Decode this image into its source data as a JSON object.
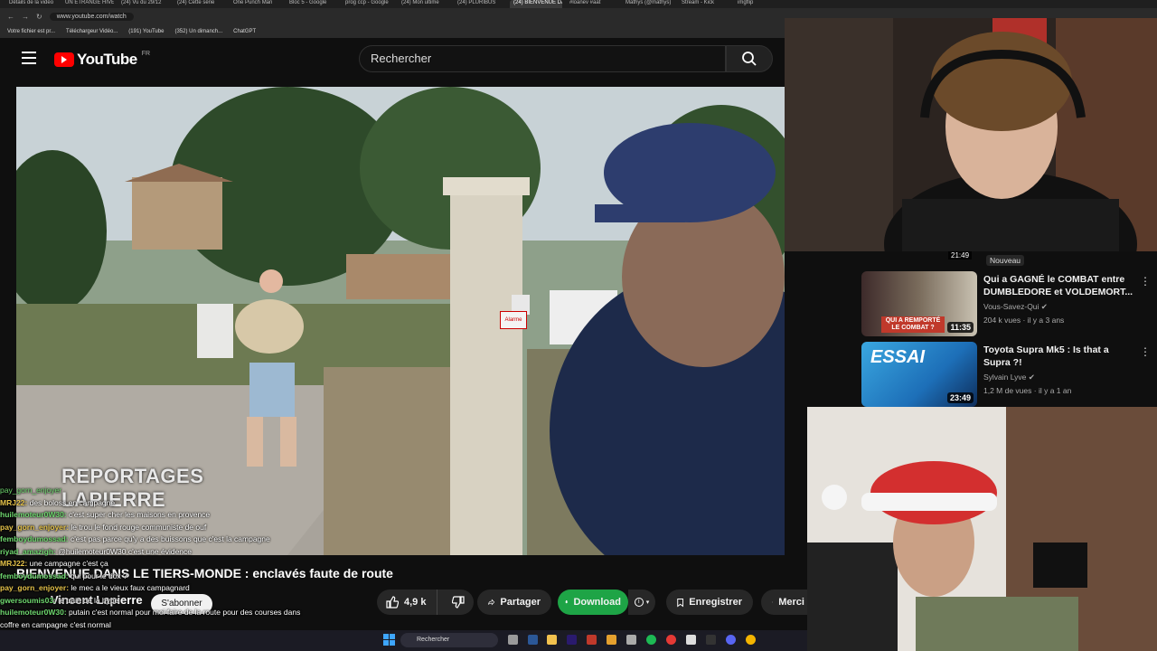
{
  "browser": {
    "tabs": [
      {
        "label": "Détails de la vidéo",
        "active": false
      },
      {
        "label": "UN ÉTRANGE HIVE",
        "active": false
      },
      {
        "label": "(24) Vu du 29/12",
        "active": false
      },
      {
        "label": "(24) Cette série",
        "active": false
      },
      {
        "label": "One Punch Man",
        "active": false
      },
      {
        "label": "Bloc 5 - Google",
        "active": false
      },
      {
        "label": "prog ccp - Google",
        "active": false
      },
      {
        "label": "(24) Mon ultime",
        "active": false
      },
      {
        "label": "(24) PLURIBUS",
        "active": false
      },
      {
        "label": "(24) BIENVENUE DANS",
        "active": true
      },
      {
        "label": "#loanev #aat",
        "active": false
      },
      {
        "label": "Mathys (@mathys)",
        "active": false
      },
      {
        "label": "Stream - Kick",
        "active": false
      },
      {
        "label": "imgflip",
        "active": false
      }
    ],
    "url": "www.youtube.com/watch",
    "bookmarks": [
      "Votre fichier est pr...",
      "Téléchargeur Vidéo...",
      "(191) YouTube",
      "(352) Un dimanch...",
      "ChatGPT"
    ]
  },
  "youtube": {
    "logo_text": "YouTube",
    "region": "FR",
    "search_placeholder": "Rechercher"
  },
  "video": {
    "overlay_line1": "REPORTAGES",
    "overlay_line2": "LAPIERRE",
    "sign_text": "Alarme",
    "title": "BIENVENUE DANS LE TIERS-MONDE : enclavés faute de route",
    "channel": "Vincent Lapierre",
    "subscribe_label": "S'abonner",
    "likes": "4,9 k",
    "share_label": "Partager",
    "download_label": "Download",
    "save_label": "Enregistrer",
    "more_label": "Merci"
  },
  "chat": [
    {
      "user": "",
      "msg": "pay_gorn_enjoyer",
      "color": "#6fd86f"
    },
    {
      "user": "MRJ22",
      "msg": "des boloss en campagne",
      "color": "#e6c34a"
    },
    {
      "user": "huilemoteur0W30",
      "msg": "c'est super cher les maisons en provence",
      "color": "#6fd86f"
    },
    {
      "user": "pay_gorn_enjoyer",
      "msg": "le trou le fond rouge communiste de ouf",
      "color": "#e6c34a"
    },
    {
      "user": "femboydumossad",
      "msg": "c'est pas parce qu'y a des buissons que c'est la campagne",
      "color": "#6fd86f"
    },
    {
      "user": "riyad_amazigh",
      "msg": "@huilemoteur0W30 c'est une évidence",
      "color": "#6fd86f"
    },
    {
      "user": "MRJ22",
      "msg": "une campagne c'est ça",
      "color": "#e6c34a"
    },
    {
      "user": "femboydumossad",
      "msg": "qui pour le dox ?",
      "color": "#6fd86f"
    },
    {
      "user": "pay_gorn_enjoyer",
      "msg": "le mec a le vieux faux campagnard",
      "color": "#e6c34a"
    },
    {
      "user": "gwersoumis03",
      "msg": "le train de la hype",
      "color": "#6fd86f"
    },
    {
      "user": "huilemoteur0W30",
      "msg": "putain c'est normal pour moi faire de la route pour des courses dans",
      "color": "#6fd86f"
    },
    {
      "user": "",
      "msg": "coffre en campagne c'est normal",
      "color": "#ffffff"
    },
    {
      "user": "pay_gorn_enjoyer",
      "msg": "pk le sont pas bourré",
      "color": "#e6c34a"
    }
  ],
  "taskbar": {
    "search_label": "Rechercher"
  },
  "recommendations": {
    "prev_duration": "21:49",
    "new_badge": "Nouveau",
    "items": [
      {
        "title": "Qui a GAGNÉ le COMBAT entre DUMBLEDORE et VOLDEMORT...",
        "channel": "Vous-Savez-Qui",
        "meta": "204 k vues · il y a 3 ans",
        "duration": "11:35",
        "thumb_caption": "QUI A REMPORTÉ LE COMBAT ?"
      },
      {
        "title": "Toyota Supra Mk5 : Is that a Supra ?!",
        "channel": "Sylvain Lyve",
        "meta": "1,2 M de vues · il y a 1 an",
        "duration": "23:49",
        "thumb_caption": "ESSAI"
      }
    ]
  },
  "colors": {
    "yt_red": "#ff0000",
    "download_green": "#1ea446",
    "bg": "#0f0f0f"
  }
}
